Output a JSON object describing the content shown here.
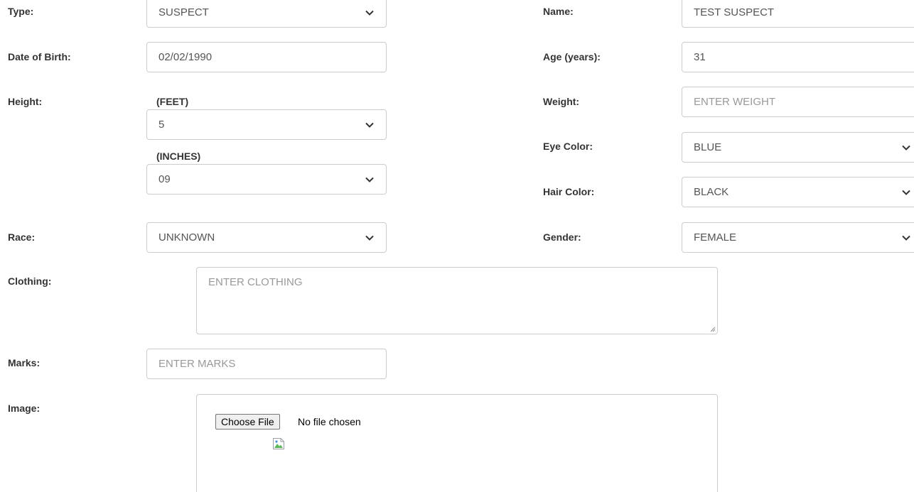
{
  "form": {
    "type": {
      "label": "Type:",
      "value": "SUSPECT"
    },
    "name": {
      "label": "Name:",
      "value": "TEST SUSPECT"
    },
    "dob": {
      "label": "Date of Birth:",
      "value": "02/02/1990"
    },
    "age": {
      "label": "Age (years):",
      "value": "31"
    },
    "height": {
      "label": "Height:",
      "feet_label": "(FEET)",
      "feet_value": "5",
      "inches_label": "(INCHES)",
      "inches_value": "09"
    },
    "weight": {
      "label": "Weight:",
      "placeholder": "ENTER WEIGHT"
    },
    "eye_color": {
      "label": "Eye Color:",
      "value": "BLUE"
    },
    "hair_color": {
      "label": "Hair Color:",
      "value": "BLACK"
    },
    "race": {
      "label": "Race:",
      "value": "UNKNOWN"
    },
    "gender": {
      "label": "Gender:",
      "value": "FEMALE"
    },
    "clothing": {
      "label": "Clothing:",
      "placeholder": "ENTER CLOTHING"
    },
    "marks": {
      "label": "Marks:",
      "placeholder": "ENTER MARKS"
    },
    "image": {
      "label": "Image:",
      "button": "Choose File",
      "status": "No file chosen"
    }
  },
  "icons": {
    "dropdown": "chevron-down-icon",
    "preview": "broken-image-icon",
    "resize": "resize-grip-icon"
  },
  "colors": {
    "border": "#cccccc",
    "label_text": "#333333",
    "value_text": "#555555",
    "placeholder_text": "#999999"
  }
}
